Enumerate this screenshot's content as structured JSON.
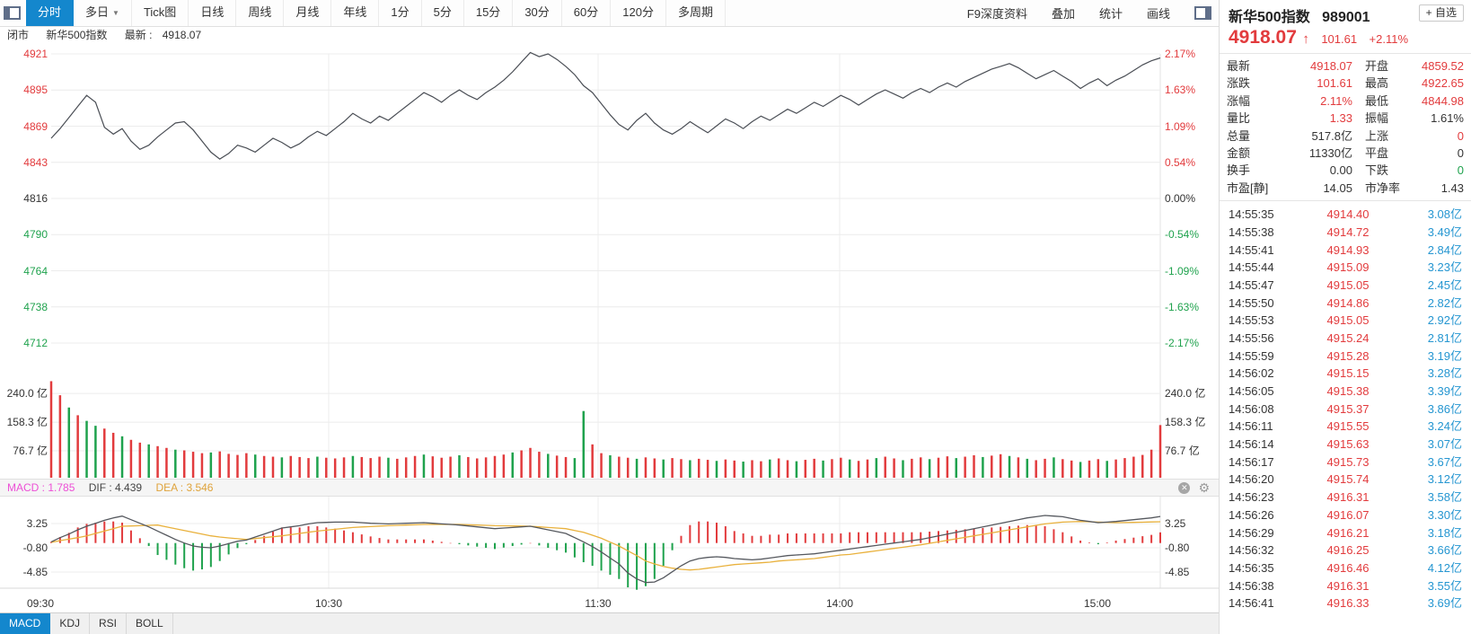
{
  "toolbar": {
    "tabs": [
      {
        "label": "分时",
        "selected": true
      },
      {
        "label": "多日",
        "dropdown": true
      },
      {
        "label": "Tick图"
      },
      {
        "label": "日线"
      },
      {
        "label": "周线"
      },
      {
        "label": "月线"
      },
      {
        "label": "年线"
      },
      {
        "label": "1分"
      },
      {
        "label": "5分"
      },
      {
        "label": "15分"
      },
      {
        "label": "30分"
      },
      {
        "label": "60分"
      },
      {
        "label": "120分"
      },
      {
        "label": "多周期"
      }
    ],
    "right_menu": [
      "F9深度资料",
      "叠加",
      "统计",
      "画线"
    ]
  },
  "status_bar": {
    "market_status": "闭市",
    "name": "新华500指数",
    "latest_label": "最新 :",
    "latest_value": "4918.07"
  },
  "stock_header": {
    "name": "新华500指数",
    "code": "989001",
    "add_watch": "+ 自选",
    "price": "4918.07",
    "arrow": "↑",
    "change": "101.61",
    "change_pct": "+2.11%"
  },
  "stats": {
    "rows": [
      {
        "l1": "最新",
        "v1": "4918.07",
        "c1": "red",
        "l2": "开盘",
        "v2": "4859.52",
        "c2": "red"
      },
      {
        "l1": "涨跌",
        "v1": "101.61",
        "c1": "red",
        "l2": "最高",
        "v2": "4922.65",
        "c2": "red"
      },
      {
        "l1": "涨幅",
        "v1": "2.11%",
        "c1": "red",
        "l2": "最低",
        "v2": "4844.98",
        "c2": "red"
      },
      {
        "l1": "量比",
        "v1": "1.33",
        "c1": "red",
        "l2": "振幅",
        "v2": "1.61%",
        "c2": "black"
      },
      {
        "l1": "总量",
        "v1": "517.8亿",
        "c1": "black",
        "l2": "上涨",
        "v2": "0",
        "c2": "red"
      },
      {
        "l1": "金额",
        "v1": "11330亿",
        "c1": "black",
        "l2": "平盘",
        "v2": "0",
        "c2": "black"
      },
      {
        "l1": "换手",
        "v1": "0.00",
        "c1": "black",
        "l2": "下跌",
        "v2": "0",
        "c2": "green"
      },
      {
        "l1": "市盈[静]",
        "v1": "14.05",
        "c1": "black",
        "l2": "市净率",
        "v2": "1.43",
        "c2": "black"
      }
    ]
  },
  "tick_list": {
    "rows": [
      [
        "14:55:35",
        "4914.40",
        "3.08亿"
      ],
      [
        "14:55:38",
        "4914.72",
        "3.49亿"
      ],
      [
        "14:55:41",
        "4914.93",
        "2.84亿"
      ],
      [
        "14:55:44",
        "4915.09",
        "3.23亿"
      ],
      [
        "14:55:47",
        "4915.05",
        "2.45亿"
      ],
      [
        "14:55:50",
        "4914.86",
        "2.82亿"
      ],
      [
        "14:55:53",
        "4915.05",
        "2.92亿"
      ],
      [
        "14:55:56",
        "4915.24",
        "2.81亿"
      ],
      [
        "14:55:59",
        "4915.28",
        "3.19亿"
      ],
      [
        "14:56:02",
        "4915.15",
        "3.28亿"
      ],
      [
        "14:56:05",
        "4915.38",
        "3.39亿"
      ],
      [
        "14:56:08",
        "4915.37",
        "3.86亿"
      ],
      [
        "14:56:11",
        "4915.55",
        "3.24亿"
      ],
      [
        "14:56:14",
        "4915.63",
        "3.07亿"
      ],
      [
        "14:56:17",
        "4915.73",
        "3.67亿"
      ],
      [
        "14:56:20",
        "4915.74",
        "3.12亿"
      ],
      [
        "14:56:23",
        "4916.31",
        "3.58亿"
      ],
      [
        "14:56:26",
        "4916.07",
        "3.30亿"
      ],
      [
        "14:56:29",
        "4916.21",
        "3.18亿"
      ],
      [
        "14:56:32",
        "4916.25",
        "3.66亿"
      ],
      [
        "14:56:35",
        "4916.46",
        "4.12亿"
      ],
      [
        "14:56:38",
        "4916.31",
        "3.55亿"
      ],
      [
        "14:56:41",
        "4916.33",
        "3.69亿"
      ]
    ]
  },
  "indicator_bar": {
    "macd_label": "MACD : 1.785",
    "dif_label": "DIF : 4.439",
    "dea_label": "DEA : 3.546",
    "macd": 1.785,
    "dif": 4.439,
    "dea": 3.546
  },
  "bottom_tabs": [
    {
      "label": "MACD",
      "selected": true
    },
    {
      "label": "KDJ"
    },
    {
      "label": "RSI"
    },
    {
      "label": "BOLL"
    }
  ],
  "colors": {
    "up": "#e23b3d",
    "down": "#1fa24d",
    "flat": "#333333",
    "volume_text": "#2596d1",
    "accent": "#1487cd",
    "price_line": "#4a4e55",
    "dif_line": "#55585e",
    "dea_line": "#e9b13c",
    "macd_label": "#ed4fd6",
    "grid": "#ececec",
    "plot_edge": "#e3e3e3"
  },
  "chart_data": {
    "type": "line",
    "panes": [
      "price",
      "volume",
      "macd"
    ],
    "x_axis": {
      "labels": [
        "09:30",
        "10:30",
        "11:30",
        "14:00",
        "15:00"
      ]
    },
    "price_axis": {
      "max": 4921,
      "min": 4712,
      "left_labels": [
        {
          "t": "4921",
          "c": "red"
        },
        {
          "t": "4895",
          "c": "red"
        },
        {
          "t": "4869",
          "c": "red"
        },
        {
          "t": "4843",
          "c": "red"
        },
        {
          "t": "4816",
          "c": "black"
        },
        {
          "t": "4790",
          "c": "green"
        },
        {
          "t": "4764",
          "c": "green"
        },
        {
          "t": "4738",
          "c": "green"
        },
        {
          "t": "4712",
          "c": "green"
        }
      ],
      "right_labels": [
        {
          "t": "2.17%",
          "c": "red"
        },
        {
          "t": "1.63%",
          "c": "red"
        },
        {
          "t": "1.09%",
          "c": "red"
        },
        {
          "t": "0.54%",
          "c": "red"
        },
        {
          "t": "0.00%",
          "c": "black"
        },
        {
          "t": "-0.54%",
          "c": "green"
        },
        {
          "t": "-1.09%",
          "c": "green"
        },
        {
          "t": "-1.63%",
          "c": "green"
        },
        {
          "t": "-2.17%",
          "c": "green"
        }
      ]
    },
    "volume_axis": {
      "labels": [
        "240.0 亿",
        "158.3 亿",
        "76.7 亿"
      ],
      "values": [
        240.0,
        158.3,
        76.7
      ],
      "unit": "亿"
    },
    "macd_axis": {
      "labels": [
        "3.25",
        "-0.80",
        "-4.85"
      ],
      "values": [
        3.25,
        -0.8,
        -4.85
      ]
    },
    "price": [
      4860,
      4867,
      4875,
      4883,
      4891,
      4886,
      4868,
      4863,
      4867,
      4858,
      4852,
      4855,
      4861,
      4866,
      4871,
      4872,
      4866,
      4858,
      4850,
      4845,
      4849,
      4855,
      4853,
      4850,
      4855,
      4860,
      4857,
      4853,
      4856,
      4861,
      4865,
      4862,
      4867,
      4872,
      4878,
      4874,
      4871,
      4876,
      4873,
      4878,
      4883,
      4888,
      4893,
      4890,
      4886,
      4891,
      4895,
      4891,
      4888,
      4893,
      4897,
      4902,
      4908,
      4915,
      4922,
      4919,
      4921,
      4917,
      4912,
      4906,
      4898,
      4893,
      4885,
      4877,
      4870,
      4866,
      4873,
      4878,
      4871,
      4866,
      4863,
      4867,
      4872,
      4868,
      4864,
      4869,
      4874,
      4871,
      4867,
      4872,
      4876,
      4873,
      4877,
      4881,
      4878,
      4882,
      4886,
      4883,
      4887,
      4891,
      4888,
      4884,
      4888,
      4892,
      4895,
      4892,
      4889,
      4893,
      4896,
      4893,
      4897,
      4900,
      4897,
      4901,
      4904,
      4907,
      4910,
      4912,
      4914,
      4911,
      4907,
      4903,
      4906,
      4909,
      4905,
      4901,
      4896,
      4900,
      4903,
      4898,
      4902,
      4905,
      4909,
      4913,
      4916,
      4918.07
    ],
    "volume": [
      275,
      235,
      200,
      178,
      162,
      148,
      140,
      128,
      118,
      108,
      100,
      95,
      90,
      85,
      80,
      78,
      74,
      70,
      72,
      75,
      68,
      65,
      70,
      66,
      62,
      60,
      58,
      62,
      59,
      56,
      60,
      57,
      55,
      58,
      62,
      59,
      56,
      60,
      57,
      54,
      58,
      62,
      66,
      61,
      57,
      60,
      64,
      59,
      55,
      58,
      62,
      66,
      72,
      78,
      85,
      74,
      68,
      63,
      59,
      56,
      190,
      95,
      70,
      64,
      60,
      57,
      54,
      58,
      55,
      52,
      56,
      53,
      50,
      54,
      51,
      48,
      52,
      49,
      46,
      50,
      47,
      52,
      55,
      50,
      47,
      51,
      54,
      49,
      53,
      57,
      52,
      48,
      52,
      56,
      60,
      55,
      50,
      54,
      58,
      53,
      57,
      61,
      56,
      60,
      64,
      59,
      63,
      67,
      62,
      58,
      54,
      50,
      54,
      58,
      53,
      49,
      45,
      49,
      53,
      48,
      52,
      56,
      60,
      65,
      80,
      150
    ],
    "volume_colors": "rrgrggrrgrrgrrgrrrgrrrrgrrgrrrgrrrgrrrgrrrgrrrgrrrrrgrrrgrrggrrgrrgrrgrrgrrgrrgrrgrrgrrgrrgrrgrrgrrgrrgrrgrrgrgrrgrrgrrgrrrrrr",
    "dif": [
      0.2,
      0.9,
      1.5,
      2.2,
      2.8,
      3.3,
      3.8,
      4.2,
      4.5,
      3.9,
      3.3,
      2.7,
      2.0,
      1.3,
      0.6,
      0.0,
      -0.5,
      -0.7,
      -0.8,
      -0.5,
      -0.1,
      0.3,
      0.5,
      1.0,
      1.5,
      2.0,
      2.5,
      2.7,
      2.9,
      3.2,
      3.4,
      3.45,
      3.5,
      3.5,
      3.5,
      3.4,
      3.3,
      3.25,
      3.2,
      3.25,
      3.3,
      3.35,
      3.4,
      3.3,
      3.2,
      3.1,
      3.0,
      2.85,
      2.7,
      2.55,
      2.4,
      2.5,
      2.6,
      2.7,
      2.8,
      2.5,
      2.2,
      1.9,
      1.6,
      0.9,
      0.2,
      -0.6,
      -1.5,
      -2.5,
      -3.5,
      -5.0,
      -6.0,
      -6.6,
      -6.5,
      -5.8,
      -4.8,
      -3.8,
      -3.0,
      -2.6,
      -2.4,
      -2.3,
      -2.4,
      -2.6,
      -2.7,
      -2.8,
      -2.7,
      -2.5,
      -2.3,
      -2.1,
      -2.0,
      -1.9,
      -1.8,
      -1.6,
      -1.4,
      -1.2,
      -1.0,
      -0.8,
      -0.6,
      -0.4,
      -0.2,
      0.0,
      0.2,
      0.4,
      0.6,
      0.9,
      1.2,
      1.5,
      1.8,
      2.1,
      2.4,
      2.7,
      3.0,
      3.3,
      3.6,
      3.9,
      4.2,
      4.4,
      4.6,
      4.5,
      4.4,
      4.1,
      3.8,
      3.6,
      3.4,
      3.5,
      3.6,
      3.75,
      3.9,
      4.05,
      4.2,
      4.44
    ],
    "dea": [
      0.1,
      0.4,
      0.65,
      0.9,
      1.2,
      1.6,
      2.0,
      2.4,
      2.8,
      2.85,
      2.9,
      2.95,
      3.0,
      2.7,
      2.4,
      2.1,
      1.8,
      1.5,
      1.2,
      1.0,
      0.85,
      0.72,
      0.6,
      0.75,
      0.9,
      1.05,
      1.2,
      1.4,
      1.6,
      1.8,
      2.0,
      2.15,
      2.3,
      2.45,
      2.6,
      2.68,
      2.75,
      2.83,
      2.9,
      2.95,
      3.0,
      3.05,
      3.1,
      3.1,
      3.1,
      3.1,
      3.1,
      3.05,
      3.0,
      2.95,
      2.9,
      2.88,
      2.85,
      2.83,
      2.8,
      2.7,
      2.6,
      2.5,
      2.4,
      2.1,
      1.8,
      1.3,
      0.8,
      0.15,
      -0.5,
      -1.3,
      -2.1,
      -3.0,
      -3.5,
      -3.9,
      -4.2,
      -4.4,
      -4.5,
      -4.4,
      -4.2,
      -4.0,
      -3.8,
      -3.6,
      -3.5,
      -3.4,
      -3.3,
      -3.2,
      -3.0,
      -2.9,
      -2.8,
      -2.7,
      -2.6,
      -2.4,
      -2.2,
      -2.0,
      -1.9,
      -1.7,
      -1.5,
      -1.3,
      -1.1,
      -0.9,
      -0.7,
      -0.5,
      -0.3,
      -0.05,
      0.2,
      0.45,
      0.7,
      0.95,
      1.2,
      1.45,
      1.7,
      1.95,
      2.2,
      2.45,
      2.7,
      2.95,
      3.2,
      3.35,
      3.5,
      3.55,
      3.6,
      3.55,
      3.5,
      3.45,
      3.4,
      3.42,
      3.45,
      3.48,
      3.52,
      3.55
    ]
  }
}
